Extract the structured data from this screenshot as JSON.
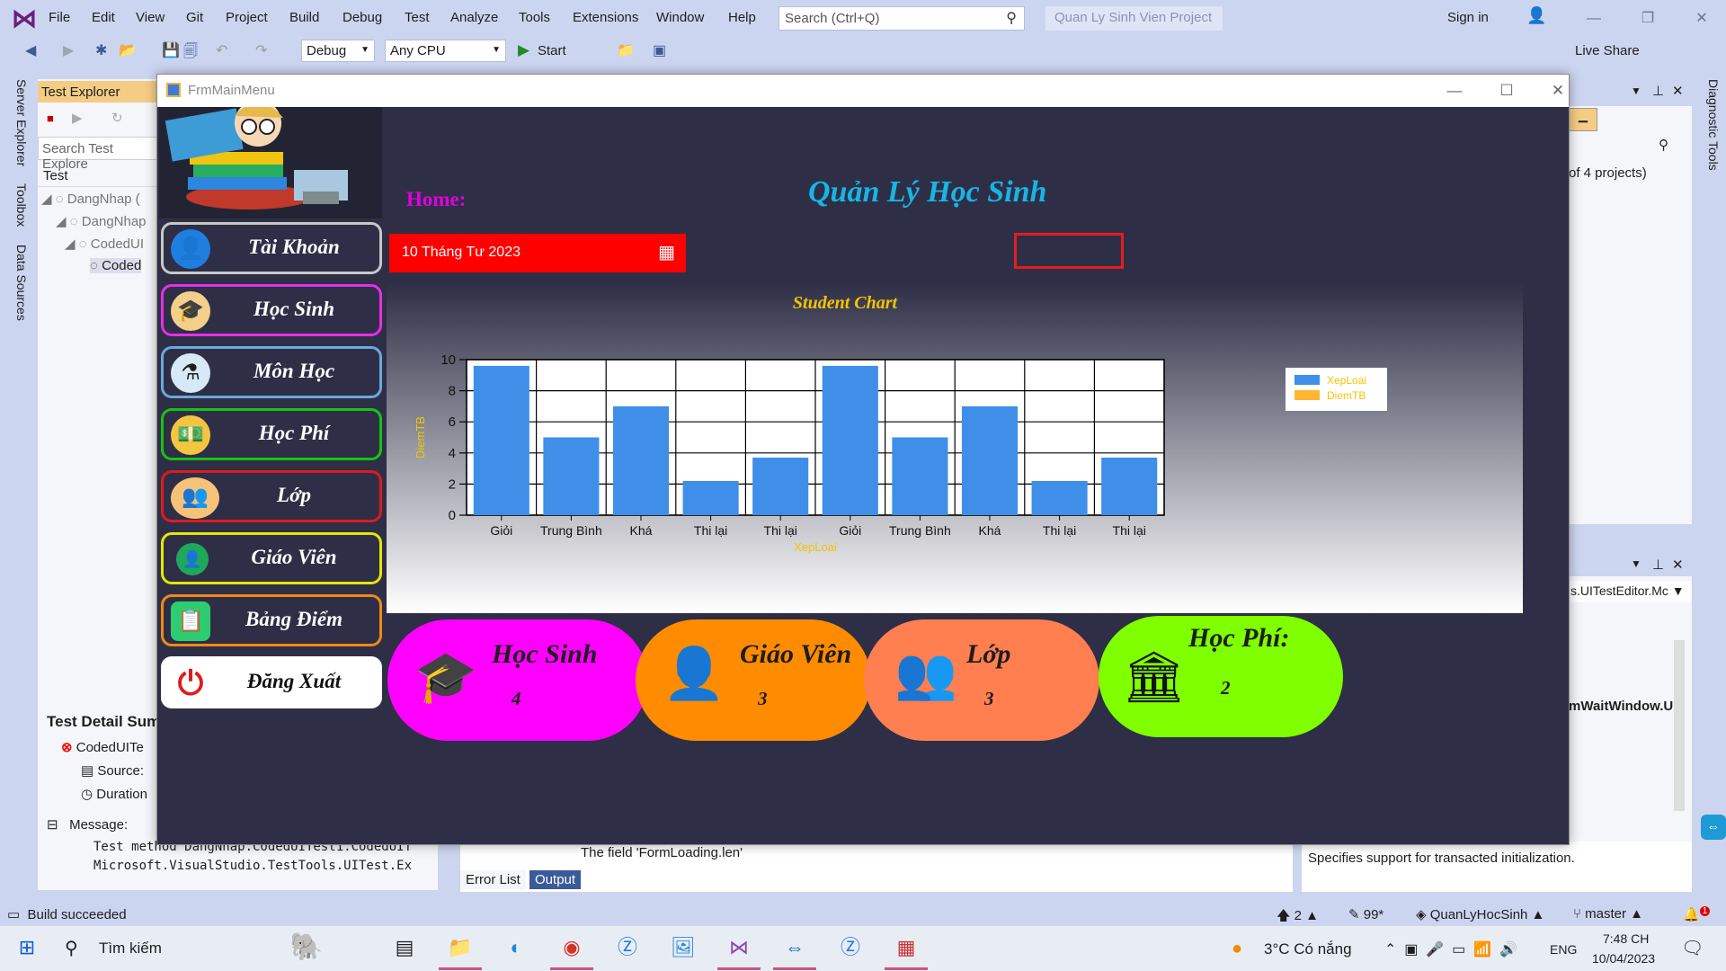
{
  "vs": {
    "menu": [
      "File",
      "Edit",
      "View",
      "Git",
      "Project",
      "Build",
      "Debug",
      "Test",
      "Analyze",
      "Tools",
      "Extensions",
      "Window",
      "Help"
    ],
    "search_placeholder": "Search (Ctrl+Q)",
    "solution_name": "Quan Ly Sinh Vien Project",
    "signin": "Sign in",
    "config": "Debug",
    "platform": "Any CPU",
    "start": "Start",
    "live_share": "Live Share",
    "left_tabs": [
      "Server Explorer",
      "Toolbox",
      "Data Sources"
    ],
    "right_tabs": [
      "Diagnostic Tools"
    ],
    "test_explorer": {
      "title": "Test Explorer",
      "search": "Search Test Explore",
      "header": "Test",
      "tree": [
        "DangNhap (",
        "DangNhap",
        "CodedUI",
        "Coded"
      ],
      "detail_title": "Test Detail Sum",
      "detail_name": "CodedUITe",
      "source_label": "Source:",
      "duration_label": "Duration",
      "message_label": "Message:",
      "message_line1": "Test method DangNhap.CodedUITest1.CodedUIT",
      "message_line2": "Microsoft.VisualStudio.TestTools.UITest.Ex"
    },
    "right_panel": {
      "projects_text": "of 4 projects)",
      "editor_combo": "s.UITestEditor.Mc",
      "wait_window": "mWaitWindow.U",
      "props_desc": "Specifies support for transacted initialization."
    },
    "output": {
      "line": "The field 'FormLoading.len'",
      "tabs": [
        "Error List",
        "Output"
      ]
    },
    "status": {
      "build": "Build succeeded",
      "up_count": "2",
      "zoom": "99*",
      "project": "QuanLyHocSinh",
      "branch": "master",
      "notif": "1"
    }
  },
  "taskbar": {
    "search": "Tìm kiếm",
    "weather": "3°C  Có nắng",
    "lang": "ENG",
    "time": "7:48 CH",
    "date": "10/04/2023"
  },
  "app": {
    "title": "FrmMainMenu",
    "home_label": "Home:",
    "heading": "Quản Lý Học Sinh",
    "date": "10 Tháng Tư 2023",
    "nav": [
      {
        "label": "Tài Khoản",
        "color": "#c8c8c8",
        "icon": "user-icon"
      },
      {
        "label": "Học Sinh",
        "color": "#e62ee6",
        "icon": "graduate-icon"
      },
      {
        "label": "Môn Học",
        "color": "#6aa9dd",
        "icon": "flask-icon"
      },
      {
        "label": "Học Phí",
        "color": "#16c316",
        "icon": "money-icon"
      },
      {
        "label": "Lớp",
        "color": "#dd1b1b",
        "icon": "classroom-icon"
      },
      {
        "label": "Giáo Viên",
        "color": "#e6e600",
        "icon": "teacher-icon"
      },
      {
        "label": "Bảng Điểm",
        "color": "#f08a16",
        "icon": "scoreboard-icon"
      },
      {
        "label": "Đăng Xuất",
        "color": "#ffffff",
        "icon": "power-icon"
      }
    ],
    "stats": [
      {
        "title": "Học Sinh",
        "value": "4",
        "color": "#ff00ff"
      },
      {
        "title": "Giáo Viên",
        "value": "3",
        "color": "#ff8c00"
      },
      {
        "title": "Lớp",
        "value": "3",
        "color": "#ff7f50"
      },
      {
        "title": "Học Phí:",
        "value": "2",
        "color": "#7fff00"
      }
    ]
  },
  "chart_data": {
    "type": "bar",
    "title": "Student Chart",
    "xlabel": "XepLoai",
    "ylabel": "DiemTB",
    "categories": [
      "Giỏi",
      "Trung Bình",
      "Khá",
      "Thi lại",
      "Thi lại",
      "Giỏi",
      "Trung Bình",
      "Khá",
      "Thi lại",
      "Thi lại"
    ],
    "series": [
      {
        "name": "XepLoai",
        "color": "#3f8ee8",
        "values": [
          9.6,
          5.0,
          7.0,
          2.2,
          3.7,
          9.6,
          5.0,
          7.0,
          2.2,
          3.7
        ]
      },
      {
        "name": "DiemTB",
        "color": "#ffb733",
        "values": []
      }
    ],
    "ylim": [
      0,
      10
    ],
    "yticks": [
      0,
      2,
      4,
      6,
      8,
      10
    ],
    "grid": true,
    "legend": "top-right"
  }
}
